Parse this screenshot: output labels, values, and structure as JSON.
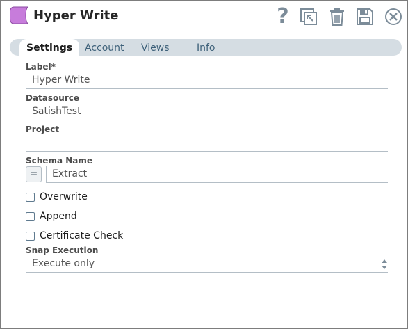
{
  "header": {
    "title": "Hyper Write",
    "help_glyph": "?",
    "icons": [
      "snap-icon",
      "help-icon",
      "export-icon",
      "delete-icon",
      "save-icon",
      "close-icon"
    ],
    "snap_icon_color": "#c77cdb"
  },
  "tabs": [
    {
      "label": "Settings",
      "active": true
    },
    {
      "label": "Account",
      "active": false
    },
    {
      "label": "Views",
      "active": false
    },
    {
      "label": "Info",
      "active": false
    }
  ],
  "form": {
    "label": {
      "title": "Label*",
      "value": "Hyper Write"
    },
    "datasource": {
      "title": "Datasource",
      "value": "SatishTest"
    },
    "project": {
      "title": "Project",
      "value": ""
    },
    "schema": {
      "title": "Schema Name",
      "expression_glyph": "=",
      "value": "Extract"
    },
    "checkboxes": [
      {
        "label": "Overwrite",
        "checked": false
      },
      {
        "label": "Append",
        "checked": false
      },
      {
        "label": "Certificate Check",
        "checked": false
      }
    ],
    "snap_execution": {
      "title": "Snap Execution",
      "value": "Execute only"
    }
  },
  "colors": {
    "accent_text": "#3d6079",
    "tab_strip": "#d5dde3",
    "toolbar_icon": "#7c8c99"
  }
}
